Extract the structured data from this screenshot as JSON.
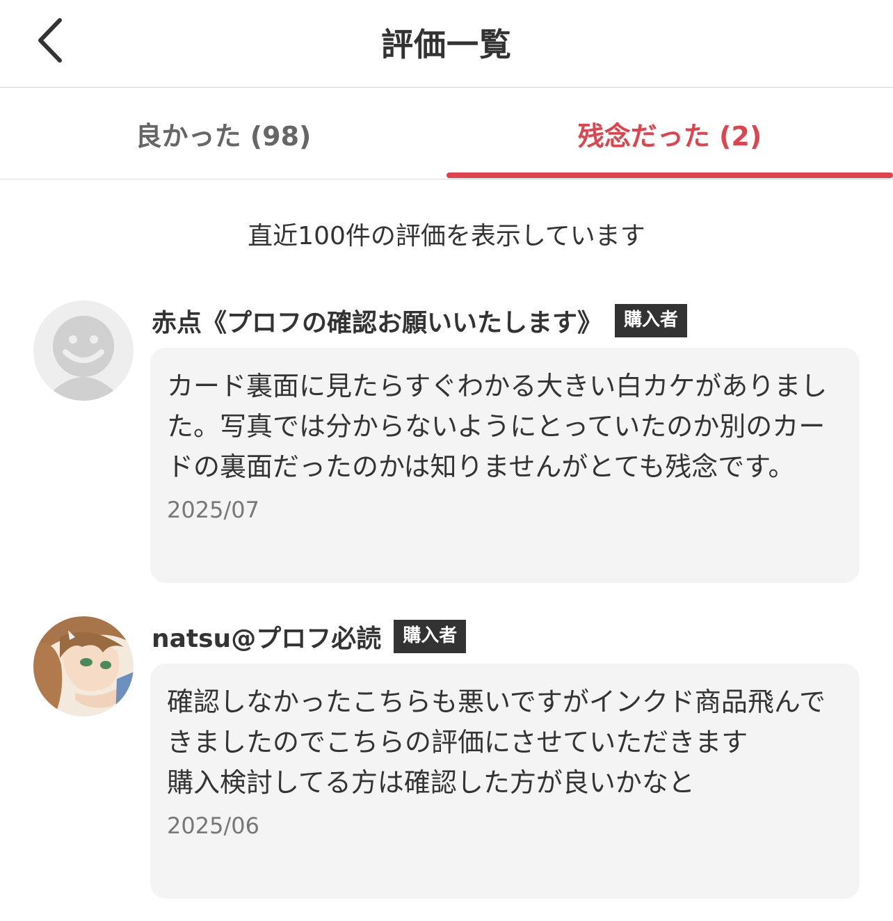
{
  "header": {
    "title": "評価一覧",
    "back_icon": "chevron-left-icon"
  },
  "tabs": [
    {
      "label": "良かった (98)",
      "active": false
    },
    {
      "label": "残念だった (2)",
      "active": true
    }
  ],
  "accent_color": "#e0434b",
  "notice": "直近100件の評価を表示しています",
  "reviews": [
    {
      "name": "赤点《プロフの確認お願いいたします》",
      "badge": "購入者",
      "avatar": "default-avatar-icon",
      "comment": "カード裏面に見たらすぐわかる大きい白カケがありました。写真では分からないようにとっていたのか別のカードの裏面だったのかは知りませんがとても残念です。",
      "date": "2025/07"
    },
    {
      "name": "natsu@プロフ必読",
      "badge": "購入者",
      "avatar": "anime-character-avatar",
      "comment": "確認しなかったこちらも悪いですがインクド商品飛んできましたのでこちらの評価にさせていただきます\n購入検討してる方は確認した方が良いかなと",
      "date": "2025/06"
    }
  ]
}
